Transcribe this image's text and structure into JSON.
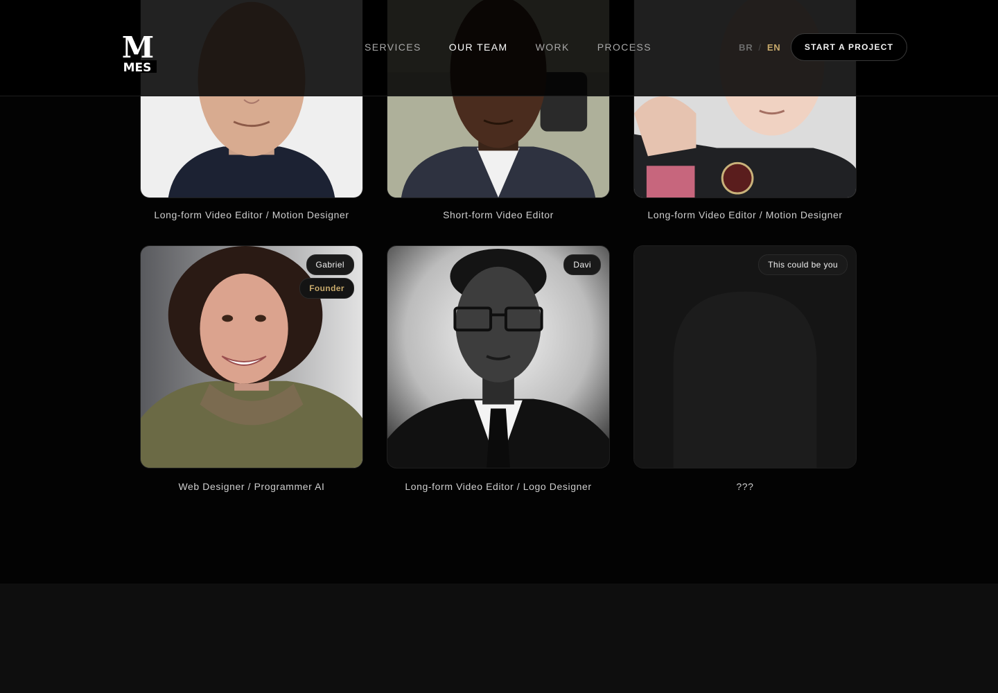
{
  "header": {
    "logo": {
      "letter": "M",
      "wordmark": "MES"
    },
    "nav": [
      {
        "label": "SERVICES",
        "active": false
      },
      {
        "label": "OUR TEAM",
        "active": true
      },
      {
        "label": "WORK",
        "active": false
      },
      {
        "label": "PROCESS",
        "active": false
      }
    ],
    "language": {
      "br": "BR",
      "separator": "/",
      "en": "EN",
      "selected": "EN"
    },
    "cta_label": "START A PROJECT"
  },
  "team": {
    "row1": [
      {
        "role": "Long-form Video Editor / Motion Designer"
      },
      {
        "role": "Short-form Video Editor"
      },
      {
        "role": "Long-form Video Editor / Motion Designer"
      }
    ],
    "row2": [
      {
        "name": "Gabriel",
        "badge": "Founder",
        "role": "Web Designer / Programmer AI"
      },
      {
        "name": "Davi",
        "role": "Long-form Video Editor / Logo Designer"
      },
      {
        "name": "This could be you",
        "role": "???"
      }
    ]
  },
  "colors": {
    "accent": "#c7a96b",
    "background": "#030303",
    "footer_band": "#0e0e0e"
  }
}
